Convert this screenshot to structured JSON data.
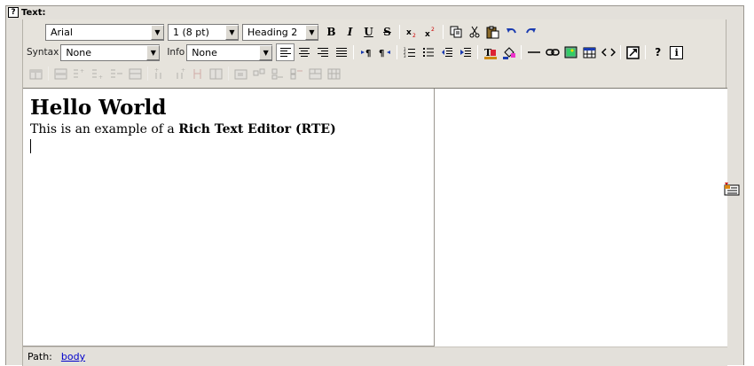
{
  "field": {
    "label": "Text:",
    "help": "?"
  },
  "toolbar": {
    "font_family": "Arial",
    "font_size": "1 (8 pt)",
    "block_format": "Heading 2",
    "syntax_label": "Syntax",
    "syntax_value": "None",
    "info_label": "Info",
    "info_value": "None",
    "bold": "B",
    "italic": "I",
    "underline": "U",
    "strike": "S",
    "help": "?",
    "info_button": "i"
  },
  "document": {
    "heading": "Hello World",
    "text_before": "This is an example of a",
    "text_bold": "Rich Text Editor (RTE)"
  },
  "status": {
    "path_label": "Path:",
    "path_value": "body"
  }
}
